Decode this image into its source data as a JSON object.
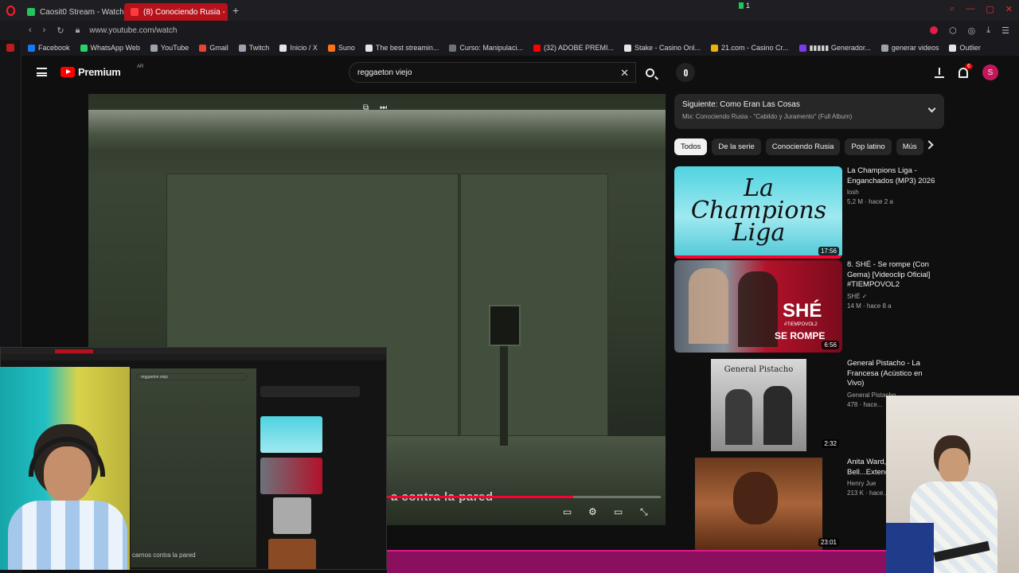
{
  "browser": {
    "tabs": [
      {
        "title": "Caosit0 Stream - Watch Li",
        "color": "#22c55e"
      },
      {
        "title": "(8) Conociendo Rusia -",
        "color": "#ff3b3b",
        "active": true
      }
    ],
    "tab_counter": "1",
    "url": "www.youtube.com/watch",
    "bookmarks": [
      {
        "label": "Facebook",
        "color": "#1877f2"
      },
      {
        "label": "WhatsApp Web",
        "color": "#25d366"
      },
      {
        "label": "YouTube",
        "color": "#9ca3af"
      },
      {
        "label": "Gmail",
        "color": "#ea4335"
      },
      {
        "label": "Twitch",
        "color": "#9ca3af"
      },
      {
        "label": "Inicio / X",
        "color": "#e5e5e5"
      },
      {
        "label": "Suno",
        "color": "#f97316"
      },
      {
        "label": "The best streamin...",
        "color": "#e5e5e5"
      },
      {
        "label": "Curso: Manipulaci...",
        "color": "#6b7280"
      },
      {
        "label": "(32) ADOBE PREMI...",
        "color": "#ff0000"
      },
      {
        "label": "Stake - Casino Onl...",
        "color": "#e5e5e5"
      },
      {
        "label": "21.com - Casino Cr...",
        "color": "#eab308"
      },
      {
        "label": "▮▮▮▮▮ Generador...",
        "color": "#7c3aed"
      },
      {
        "label": "generar videos",
        "color": "#9ca3af"
      },
      {
        "label": "Outlier",
        "color": "#e5e5e5"
      }
    ]
  },
  "youtube": {
    "logo_text": "Premium",
    "region": "AR",
    "search_query": "reggaeton viejo",
    "notifications": "6",
    "avatar_letter": "S",
    "player": {
      "caption": "a contra la pared",
      "progress": 0.68
    },
    "up_next": {
      "line1": "Siguiente: Como Eran Las Cosas",
      "line2": "Mix: Conociendo Rusia - \"Cabildo y Juramento\" (Full Album)"
    },
    "chips": [
      "Todos",
      "De la serie",
      "Conociendo Rusia",
      "Pop latino",
      "Mús"
    ],
    "recommendations": [
      {
        "title": "La Champions Liga - Enganchados (MP3) 2026",
        "channel": "losh",
        "views": "5,2 M · hace 2 a",
        "duration": "17:56"
      },
      {
        "title": "8. SHÉ - Se rompe (Con Gema) [Videoclip Oficial] #TIEMPOVOL2",
        "channel": "SHÉ ✓",
        "views": "14 M · hace 8 a",
        "duration": "6:56"
      },
      {
        "title": "General Pistacho - La Francesa (Acústico en Vivo)",
        "channel": "General Pistacho",
        "views": "478 · hace...",
        "duration": "2:32"
      },
      {
        "title": "Anita Ward, Ring My Bell...Extended",
        "channel": "Henry Jue",
        "views": "213 K · hace...",
        "duration": "23:01"
      }
    ],
    "thumb_texts": {
      "champions": "La Champions Liga",
      "she_brand": "SHÉ",
      "she_sub": "#TIEMPOVOL2",
      "she_title": "SE ROMPE",
      "pistacho": "General Pistacho"
    }
  },
  "mini_capture": {
    "search": "reggaeton viejo",
    "caption": "carnos contra la pared"
  }
}
